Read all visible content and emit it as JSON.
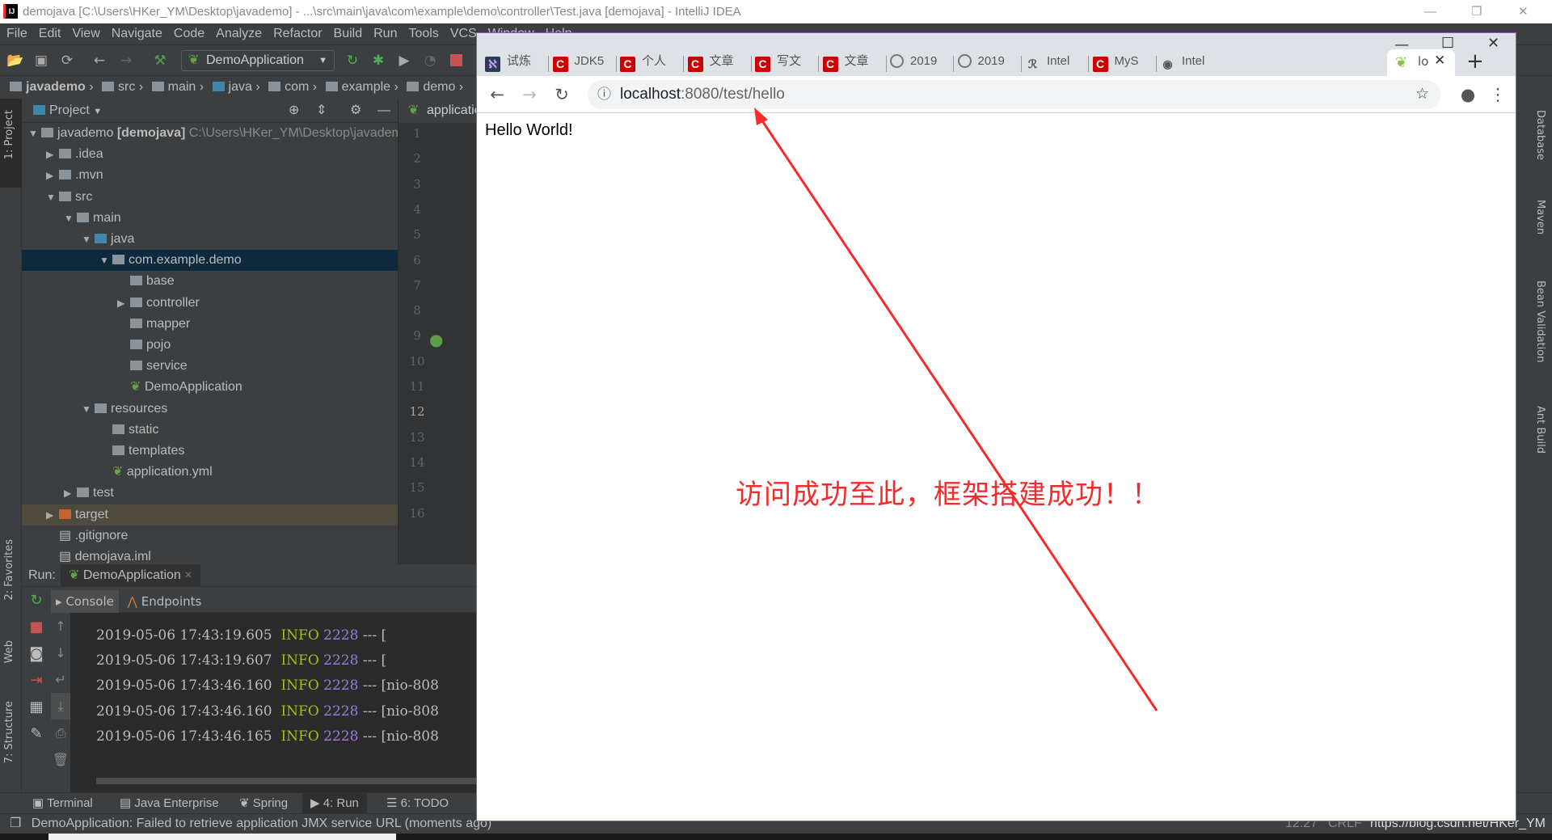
{
  "window": {
    "title": "demojava [C:\\Users\\HKer_YM\\Desktop\\javademo] - ...\\src\\main\\java\\com\\example\\demo\\controller\\Test.java [demojava] - IntelliJ IDEA",
    "logo": "IJ"
  },
  "menu": [
    "File",
    "Edit",
    "View",
    "Navigate",
    "Code",
    "Analyze",
    "Refactor",
    "Build",
    "Run",
    "Tools",
    "VCS",
    "Window",
    "Help"
  ],
  "toolbar": {
    "run_config": "DemoApplication"
  },
  "breadcrumb": [
    "javademo",
    "src",
    "main",
    "java",
    "com",
    "example",
    "demo"
  ],
  "project": {
    "header": "Project",
    "tree": [
      {
        "label": "javademo",
        "bold": "[demojava]",
        "path": "C:\\Users\\HKer_YM\\Desktop\\javademo"
      },
      {
        "label": ".idea"
      },
      {
        "label": ".mvn"
      },
      {
        "label": "src"
      },
      {
        "label": "main"
      },
      {
        "label": "java"
      },
      {
        "label": "com.example.demo"
      },
      {
        "label": "base"
      },
      {
        "label": "controller"
      },
      {
        "label": "mapper"
      },
      {
        "label": "pojo"
      },
      {
        "label": "service"
      },
      {
        "label": "DemoApplication"
      },
      {
        "label": "resources"
      },
      {
        "label": "static"
      },
      {
        "label": "templates"
      },
      {
        "label": "application.yml"
      },
      {
        "label": "test"
      },
      {
        "label": "target"
      },
      {
        "label": ".gitignore"
      },
      {
        "label": "demojava.iml"
      }
    ]
  },
  "editor": {
    "tab": "application.yml",
    "line_numbers": [
      "1",
      "2",
      "3",
      "4",
      "5",
      "6",
      "7",
      "8",
      "9",
      "10",
      "11",
      "12",
      "13",
      "14",
      "15",
      "16"
    ]
  },
  "left_strip": {
    "project": "1: Project",
    "favorites": "2: Favorites",
    "web": "Web",
    "structure": "7: Structure"
  },
  "right_strip": [
    "Database",
    "Maven",
    "Bean Validation",
    "Ant Build"
  ],
  "run": {
    "label": "Run:",
    "config": "DemoApplication",
    "tabs": [
      "Console",
      "Endpoints"
    ],
    "lines": [
      {
        "time": "2019-05-06 17:43:19.605",
        "level": "INFO",
        "pid": "2228",
        "rest": "--- ["
      },
      {
        "time": "2019-05-06 17:43:19.607",
        "level": "INFO",
        "pid": "2228",
        "rest": "--- ["
      },
      {
        "time": "2019-05-06 17:43:46.160",
        "level": "INFO",
        "pid": "2228",
        "rest": "--- [nio-808"
      },
      {
        "time": "2019-05-06 17:43:46.160",
        "level": "INFO",
        "pid": "2228",
        "rest": "--- [nio-808"
      },
      {
        "time": "2019-05-06 17:43:46.165",
        "level": "INFO",
        "pid": "2228",
        "rest": "--- [nio-808"
      }
    ]
  },
  "bottom_tabs": [
    "Terminal",
    "Java Enterprise",
    "Spring",
    "4: Run",
    "6: TODO"
  ],
  "status": {
    "message": "DemoApplication: Failed to retrieve application JMX service URL (moments ago)",
    "position": "12:27",
    "line_sep": "CRLF",
    "watermark": "https://blog.csdn.net/HKer_YM"
  },
  "browser": {
    "tabs": [
      {
        "label": "试炼",
        "icon": "x"
      },
      {
        "label": "JDK5",
        "icon": "c"
      },
      {
        "label": "个人",
        "icon": "c"
      },
      {
        "label": "文章",
        "icon": "c"
      },
      {
        "label": "写文",
        "icon": "c"
      },
      {
        "label": "文章",
        "icon": "c"
      },
      {
        "label": "2019",
        "icon": "g"
      },
      {
        "label": "2019",
        "icon": "g"
      },
      {
        "label": "Intel",
        "icon": "i"
      },
      {
        "label": "MyS",
        "icon": "c"
      },
      {
        "label": "Intel",
        "icon": "w"
      }
    ],
    "active_tab": "lo",
    "url_host": "localhost",
    "url_rest": ":8080/test/hello",
    "content": "Hello World!"
  },
  "annotation": {
    "text": "访问成功至此，框架搭建成功！！",
    "color": "#f52a2a"
  }
}
